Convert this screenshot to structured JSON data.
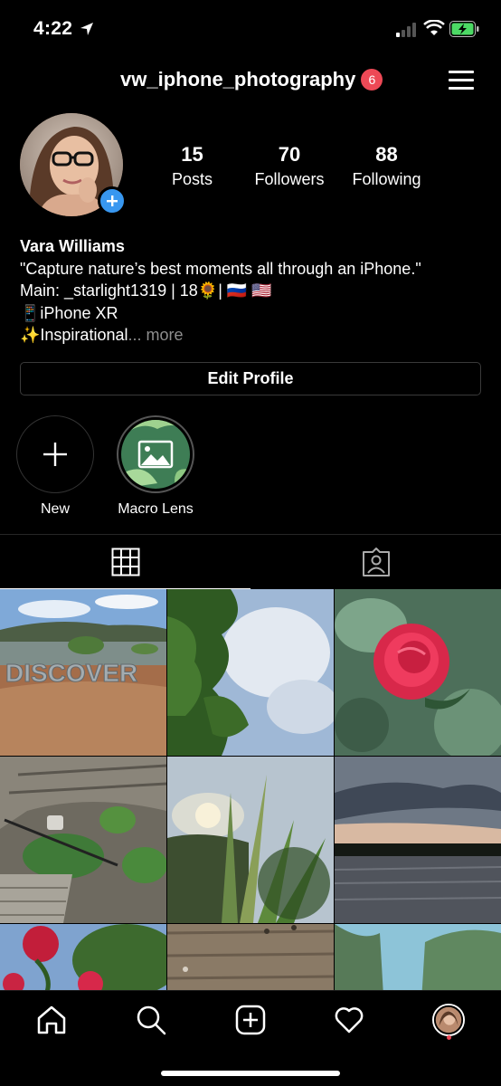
{
  "status_bar": {
    "time": "4:22"
  },
  "header": {
    "username": "vw_iphone_photography",
    "notification_count": "6"
  },
  "profile": {
    "stats": [
      {
        "value": "15",
        "label": "Posts"
      },
      {
        "value": "70",
        "label": "Followers"
      },
      {
        "value": "88",
        "label": "Following"
      }
    ],
    "name": "Vara Williams",
    "bio_lines": [
      "\"Capture nature’s best moments all through an iPhone.\"",
      "Main: _starlight1319 | 18🌻| 🇷🇺 🇺🇸",
      "📱iPhone XR",
      "✨Inspirational"
    ],
    "more_label": "... more",
    "edit_profile_label": "Edit Profile"
  },
  "highlights": [
    {
      "label": "New",
      "icon": "plus-icon"
    },
    {
      "label": "Macro Lens",
      "icon": "image-icon"
    }
  ],
  "tabs": [
    {
      "name": "grid",
      "icon": "grid-icon",
      "active": true
    },
    {
      "name": "tagged",
      "icon": "tagged-person-icon",
      "active": false
    }
  ],
  "posts": [
    {
      "subject": "beach-discover-sign",
      "overlay_text": "DISCOVER"
    },
    {
      "subject": "trees-sky"
    },
    {
      "subject": "red-rose"
    },
    {
      "subject": "garden-stairs"
    },
    {
      "subject": "sunset-grass"
    },
    {
      "subject": "lake-dusk"
    },
    {
      "subject": "red-flowers"
    },
    {
      "subject": "wood-deck"
    },
    {
      "subject": "tree-tops"
    }
  ],
  "bottom_nav": [
    {
      "name": "home",
      "icon": "home-icon"
    },
    {
      "name": "search",
      "icon": "search-icon"
    },
    {
      "name": "new-post",
      "icon": "plus-square-icon"
    },
    {
      "name": "activity",
      "icon": "heart-icon"
    },
    {
      "name": "profile",
      "icon": "avatar-icon"
    }
  ],
  "colors": {
    "accent": "#3897f0",
    "badge": "#ed4956",
    "background": "#000000"
  }
}
